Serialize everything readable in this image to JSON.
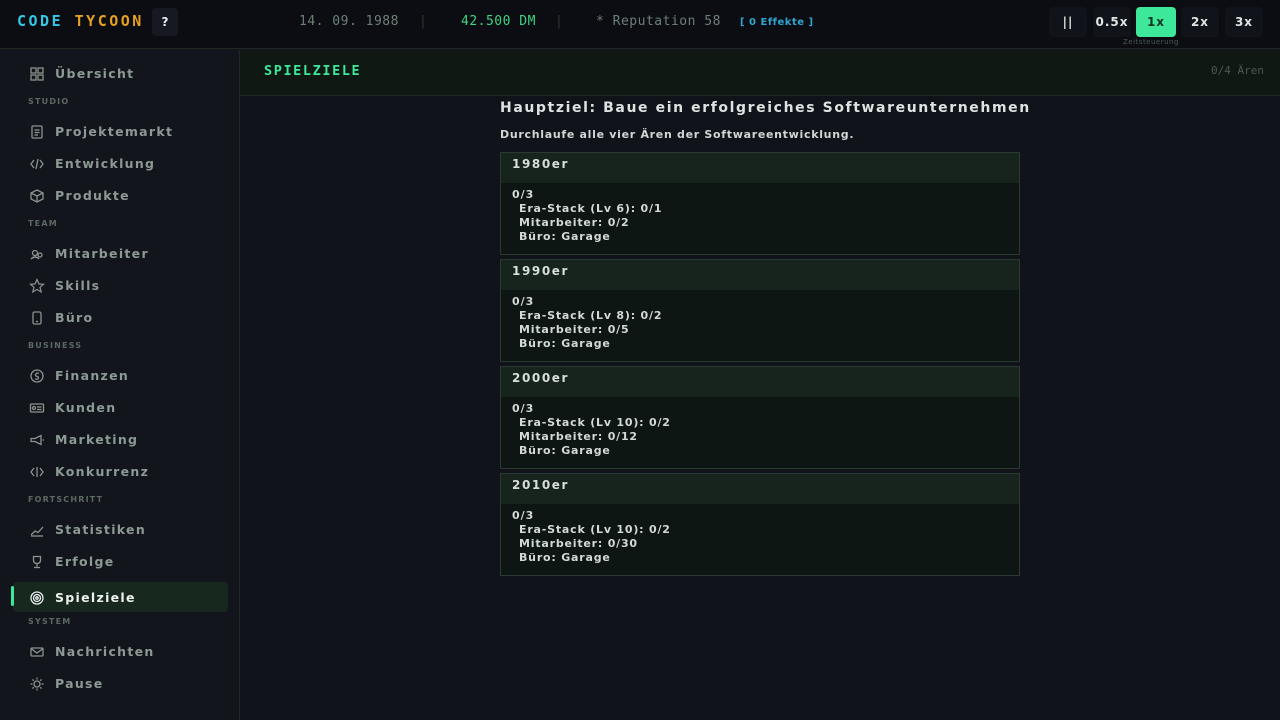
{
  "topbar": {
    "logo_part1": "CODE",
    "logo_part2": "TYCOON",
    "help_label": "?",
    "date": "14. 09. 1988",
    "separator": "|",
    "money": "42.500 DM",
    "reputation": "* Reputation 58",
    "effects": "[ 0 Effekte ]",
    "speed": {
      "pause_label": "||",
      "options": [
        "0.5x",
        "1x",
        "2x",
        "3x"
      ],
      "selected": "1x",
      "caption": "Zeitsteuerung"
    }
  },
  "sidebar": {
    "items": [
      {
        "label": "Übersicht",
        "icon": "grid-icon"
      },
      {
        "label": "Projektemarkt",
        "icon": "document-icon"
      },
      {
        "label": "Entwicklung",
        "icon": "code-icon"
      },
      {
        "label": "Produkte",
        "icon": "box-icon"
      },
      {
        "label": "Mitarbeiter",
        "icon": "people-icon"
      },
      {
        "label": "Skills",
        "icon": "star-icon"
      },
      {
        "label": "Büro",
        "icon": "phone-icon"
      },
      {
        "label": "Finanzen",
        "icon": "coin-icon"
      },
      {
        "label": "Kunden",
        "icon": "id-card-icon"
      },
      {
        "label": "Marketing",
        "icon": "megaphone-icon"
      },
      {
        "label": "Konkurrenz",
        "icon": "code-icon"
      },
      {
        "label": "Statistiken",
        "icon": "chart-icon"
      },
      {
        "label": "Erfolge",
        "icon": "trophy-icon"
      },
      {
        "label": "Spielziele",
        "icon": "target-icon"
      },
      {
        "label": "Nachrichten",
        "icon": "mail-icon"
      },
      {
        "label": "Pause",
        "icon": "sun-icon"
      }
    ],
    "active": "Spielziele",
    "sections": [
      "STUDIO",
      "TEAM",
      "BUSINESS",
      "FORTSCHRITT",
      "SYSTEM"
    ]
  },
  "main": {
    "title": "SPIELZIELE",
    "count": "0/4 Ären",
    "goal_title": "Hauptziel: Baue ein erfolgreiches Softwareunternehmen",
    "goal_subtitle": "Durchlaufe alle vier Ären der Softwareentwicklung.",
    "eras": [
      {
        "name": "1980er",
        "progress": "0/3",
        "requirements": [
          "Era-Stack (Lv 6): 0/1",
          "Mitarbeiter: 0/2",
          "Büro: Garage"
        ]
      },
      {
        "name": "1990er",
        "progress": "0/3",
        "requirements": [
          "Era-Stack (Lv 8): 0/2",
          "Mitarbeiter: 0/5",
          "Büro: Garage"
        ]
      },
      {
        "name": "2000er",
        "progress": "0/3",
        "requirements": [
          "Era-Stack (Lv 10): 0/2",
          "Mitarbeiter: 0/12",
          "Büro: Garage"
        ]
      },
      {
        "name": "2010er",
        "progress": "0/3",
        "requirements": [
          "Era-Stack (Lv 10): 0/2",
          "Mitarbeiter: 0/30",
          "Büro: Garage"
        ]
      }
    ]
  },
  "colors": {
    "accent": "#3ee89a",
    "logo_cyan": "#35c8e6",
    "logo_orange": "#e6a11f",
    "money": "#3fd382",
    "effects": "#2fa6cf"
  }
}
